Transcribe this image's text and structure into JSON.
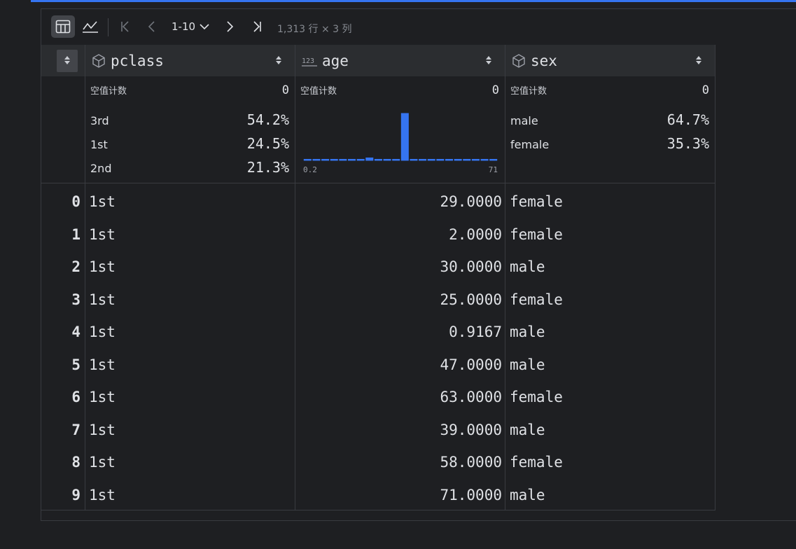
{
  "toolbar": {
    "range_label": "1-10",
    "rows_info": "1,313 行 × 3 列"
  },
  "columns": [
    {
      "name": "pclass",
      "type_icon": "cube-icon"
    },
    {
      "name": "age",
      "type_icon": "numeric-123-icon"
    },
    {
      "name": "sex",
      "type_icon": "cube-icon"
    }
  ],
  "stats": {
    "null_label": "空值计数",
    "pclass": {
      "null_count": "0",
      "freq": [
        {
          "k": "3rd",
          "p": "54.2%"
        },
        {
          "k": "1st",
          "p": "24.5%"
        },
        {
          "k": "2nd",
          "p": "21.3%"
        }
      ]
    },
    "age": {
      "null_count": "0",
      "min_label": "0.2",
      "max_label": "71"
    },
    "sex": {
      "null_count": "0",
      "freq": [
        {
          "k": "male",
          "p": "64.7%"
        },
        {
          "k": "female",
          "p": "35.3%"
        }
      ]
    }
  },
  "chart_data": {
    "type": "bar",
    "description_axis": "age histogram",
    "x_range": [
      0.2,
      71
    ],
    "bins": 22,
    "values": [
      1,
      1,
      1,
      1,
      1,
      1,
      1,
      2,
      1,
      1,
      1,
      30,
      1,
      1,
      1,
      1,
      1,
      1,
      1,
      1,
      1,
      1
    ],
    "color": "#3574f0"
  },
  "rows": [
    {
      "idx": "0",
      "pclass": "1st",
      "age": "29.0000",
      "sex": "female"
    },
    {
      "idx": "1",
      "pclass": "1st",
      "age": "2.0000",
      "sex": "female"
    },
    {
      "idx": "2",
      "pclass": "1st",
      "age": "30.0000",
      "sex": "male"
    },
    {
      "idx": "3",
      "pclass": "1st",
      "age": "25.0000",
      "sex": "female"
    },
    {
      "idx": "4",
      "pclass": "1st",
      "age": "0.9167",
      "sex": "male"
    },
    {
      "idx": "5",
      "pclass": "1st",
      "age": "47.0000",
      "sex": "male"
    },
    {
      "idx": "6",
      "pclass": "1st",
      "age": "63.0000",
      "sex": "female"
    },
    {
      "idx": "7",
      "pclass": "1st",
      "age": "39.0000",
      "sex": "male"
    },
    {
      "idx": "8",
      "pclass": "1st",
      "age": "58.0000",
      "sex": "female"
    },
    {
      "idx": "9",
      "pclass": "1st",
      "age": "71.0000",
      "sex": "male"
    }
  ]
}
